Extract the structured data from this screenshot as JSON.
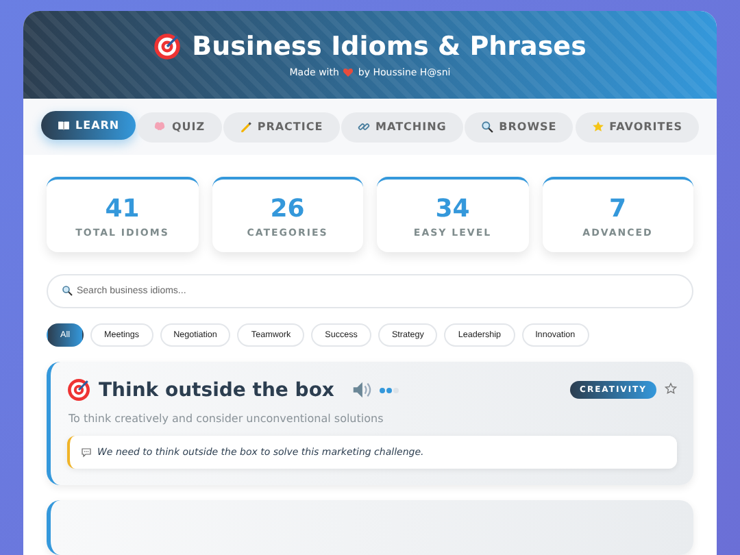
{
  "header": {
    "title": "Business Idioms & Phrases",
    "credit_before": "Made with",
    "credit_after": "by Houssine H@sni"
  },
  "tabs": [
    {
      "label": "LEARN",
      "selected": true
    },
    {
      "label": "QUIZ",
      "selected": false
    },
    {
      "label": "PRACTICE",
      "selected": false
    },
    {
      "label": "MATCHING",
      "selected": false
    },
    {
      "label": "BROWSE",
      "selected": false
    },
    {
      "label": "FAVORITES",
      "selected": false
    }
  ],
  "stats": [
    {
      "value": "41",
      "label": "TOTAL IDIOMS"
    },
    {
      "value": "26",
      "label": "CATEGORIES"
    },
    {
      "value": "34",
      "label": "EASY LEVEL"
    },
    {
      "value": "7",
      "label": "ADVANCED"
    }
  ],
  "search": {
    "placeholder": "Search business idioms..."
  },
  "filters": [
    {
      "label": "All",
      "selected": true
    },
    {
      "label": "Meetings",
      "selected": false
    },
    {
      "label": "Negotiation",
      "selected": false
    },
    {
      "label": "Teamwork",
      "selected": false
    },
    {
      "label": "Success",
      "selected": false
    },
    {
      "label": "Strategy",
      "selected": false
    },
    {
      "label": "Leadership",
      "selected": false
    },
    {
      "label": "Innovation",
      "selected": false
    }
  ],
  "idioms": [
    {
      "phrase": "Think outside the box",
      "level": 0.67,
      "category": "CREATIVITY",
      "favorite": false,
      "meaning": "To think creatively and consider unconventional solutions",
      "example": "We need to think outside the box to solve this marketing challenge."
    }
  ],
  "more_cards": true
}
